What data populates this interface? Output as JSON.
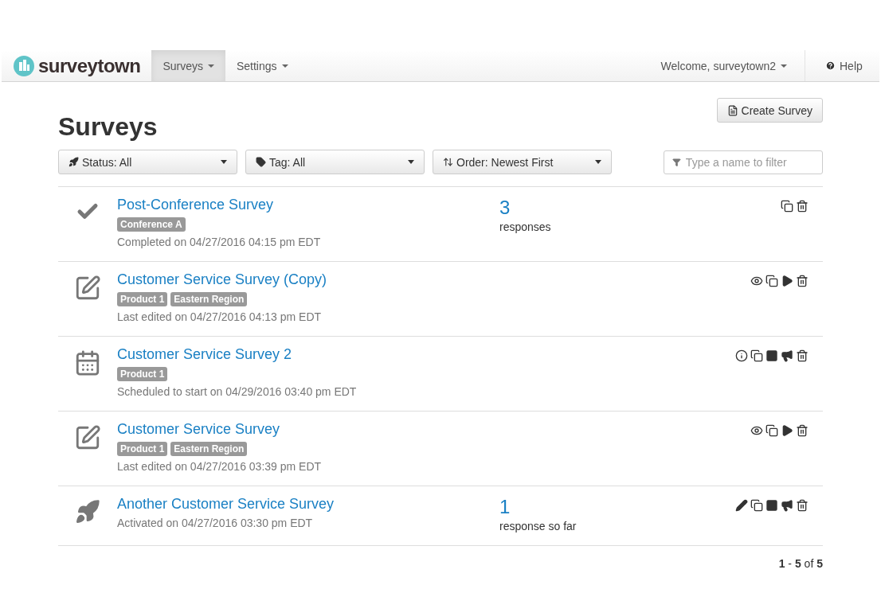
{
  "navbar": {
    "brand": "surveytown",
    "menus": [
      {
        "label": "Surveys",
        "selected": true
      },
      {
        "label": "Settings",
        "selected": false
      }
    ],
    "welcome": "Welcome, surveytown2",
    "help": "Help"
  },
  "page": {
    "title": "Surveys",
    "create_button": "Create Survey",
    "filters": [
      {
        "kind": "status",
        "label": "Status:",
        "value": "All"
      },
      {
        "kind": "tag",
        "label": "Tag:",
        "value": "All"
      },
      {
        "kind": "order",
        "label": "Order:",
        "value": "Newest First"
      }
    ],
    "search": {
      "placeholder": "Type a name to filter"
    }
  },
  "surveys": [
    {
      "kind": "completed",
      "title": "Post-Conference Survey",
      "tags": [
        "Conference A"
      ],
      "status_text": "Completed on 04/27/2016 04:15 pm EDT",
      "count": "3",
      "count_label": "responses",
      "actions": [
        {
          "kind": "copy"
        },
        {
          "kind": "delete"
        }
      ]
    },
    {
      "kind": "draft",
      "title": "Customer Service Survey (Copy)",
      "tags": [
        "Product 1",
        "Eastern Region"
      ],
      "status_text": "Last edited on 04/27/2016 04:13 pm EDT",
      "actions": [
        {
          "kind": "view"
        },
        {
          "kind": "copy"
        },
        {
          "kind": "play"
        },
        {
          "kind": "delete"
        }
      ]
    },
    {
      "kind": "scheduled",
      "title": "Customer Service Survey 2",
      "tags": [
        "Product 1"
      ],
      "status_text": "Scheduled to start on 04/29/2016 03:40 pm EDT",
      "actions": [
        {
          "kind": "info"
        },
        {
          "kind": "copy"
        },
        {
          "kind": "stop"
        },
        {
          "kind": "announce"
        },
        {
          "kind": "delete"
        }
      ]
    },
    {
      "kind": "draft",
      "title": "Customer Service Survey",
      "tags": [
        "Product 1",
        "Eastern Region"
      ],
      "status_text": "Last edited on 04/27/2016 03:39 pm EDT",
      "actions": [
        {
          "kind": "view"
        },
        {
          "kind": "copy"
        },
        {
          "kind": "play"
        },
        {
          "kind": "delete"
        }
      ]
    },
    {
      "kind": "active",
      "title": "Another Customer Service Survey",
      "status_text": "Activated on 04/27/2016 03:30 pm EDT",
      "count": "1",
      "count_label": "response so far",
      "actions": [
        {
          "kind": "edit"
        },
        {
          "kind": "copy"
        },
        {
          "kind": "stop"
        },
        {
          "kind": "announce"
        },
        {
          "kind": "delete"
        }
      ]
    }
  ],
  "pagination": "**1** - **5** of **5**"
}
